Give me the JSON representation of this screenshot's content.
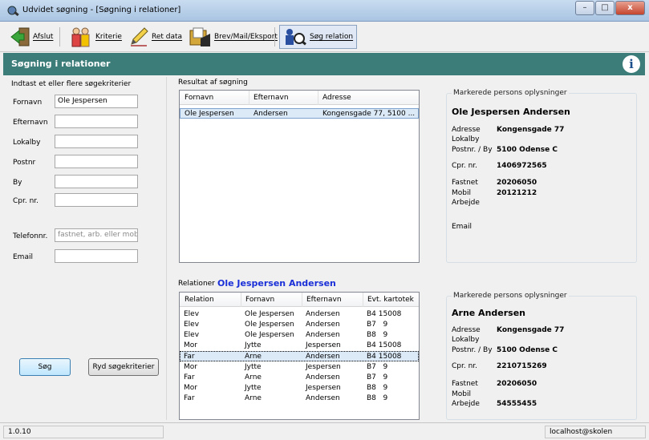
{
  "window": {
    "title": "Udvidet søgning - [Søgning i relationer]",
    "min": "–",
    "max": "□",
    "close": "x"
  },
  "toolbar": {
    "afslut": "Afslut",
    "kriterie": "Kriterie",
    "ret_data": "Ret data",
    "brev": "Brev/Mail/Eksport",
    "soeg_relation": "Søg relation"
  },
  "header": {
    "title": "Søgning i relationer",
    "info": "i"
  },
  "search": {
    "section_label": "Indtast et eller flere søgekriterier",
    "fields": {
      "fornavn": {
        "label": "Fornavn",
        "value": "Ole Jespersen"
      },
      "efternavn": {
        "label": "Efternavn",
        "value": ""
      },
      "lokalby": {
        "label": "Lokalby",
        "value": ""
      },
      "postnr": {
        "label": "Postnr",
        "value": ""
      },
      "by": {
        "label": "By",
        "value": ""
      },
      "cpr": {
        "label": "Cpr. nr.",
        "value": ""
      },
      "telefon": {
        "label": "Telefonnr.",
        "placeholder": "fastnet, arb. eller mobil"
      },
      "email": {
        "label": "Email",
        "value": ""
      }
    },
    "search_button": "Søg",
    "clear_button": "Ryd søgekriterier"
  },
  "results": {
    "label": "Resultat af søgning",
    "columns": [
      "Fornavn",
      "Efternavn",
      "Adresse"
    ],
    "rows": [
      [
        "Ole Jespersen",
        "Andersen",
        "Kongensgade 77, 5100 ..."
      ]
    ]
  },
  "person1": {
    "group_label": "Markerede persons oplysninger",
    "name": "Ole Jespersen Andersen",
    "adresse_label": "Adresse",
    "adresse": "Kongensgade 77",
    "lokalby_label": "Lokalby",
    "postnr_label": "Postnr. / By",
    "postnr": "5100 Odense C",
    "cpr_label": "Cpr. nr.",
    "cpr": "1406972565",
    "fastnet_label": "Fastnet",
    "fastnet": "20206050",
    "mobil_label": "Mobil",
    "mobil": "20121212",
    "arbejde_label": "Arbejde",
    "email_label": "Email"
  },
  "relations": {
    "label": "Relationer",
    "person_name": "Ole Jespersen Andersen",
    "columns": [
      "Relation",
      "Fornavn",
      "Efternavn",
      "Evt. kartotek"
    ],
    "rows": [
      [
        "Elev",
        "Ole Jespersen",
        "Andersen",
        "B4 15008"
      ],
      [
        "Elev",
        "Ole Jespersen",
        "Andersen",
        "B7   9"
      ],
      [
        "Elev",
        "Ole Jespersen",
        "Andersen",
        "B8   9"
      ],
      [
        "Mor",
        "Jytte",
        "Jespersen",
        "B4 15008"
      ],
      [
        "Far",
        "Arne",
        "Andersen",
        "B4 15008"
      ],
      [
        "Mor",
        "Jytte",
        "Jespersen",
        "B7   9"
      ],
      [
        "Far",
        "Arne",
        "Andersen",
        "B7   9"
      ],
      [
        "Mor",
        "Jytte",
        "Jespersen",
        "B8   9"
      ],
      [
        "Far",
        "Arne",
        "Andersen",
        "B8   9"
      ]
    ]
  },
  "person2": {
    "group_label": "Markerede persons oplysninger",
    "name": "Arne Andersen",
    "adresse_label": "Adresse",
    "adresse": "Kongensgade 77",
    "lokalby_label": "Lokalby",
    "postnr_label": "Postnr. / By",
    "postnr": "5100 Odense C",
    "cpr_label": "Cpr. nr.",
    "cpr": "2210715269",
    "fastnet_label": "Fastnet",
    "fastnet": "20206050",
    "mobil_label": "Mobil",
    "arbejde_label": "Arbejde",
    "arbejde": "54555455"
  },
  "status": {
    "version": "1.0.10",
    "server": "localhost@skolen"
  }
}
